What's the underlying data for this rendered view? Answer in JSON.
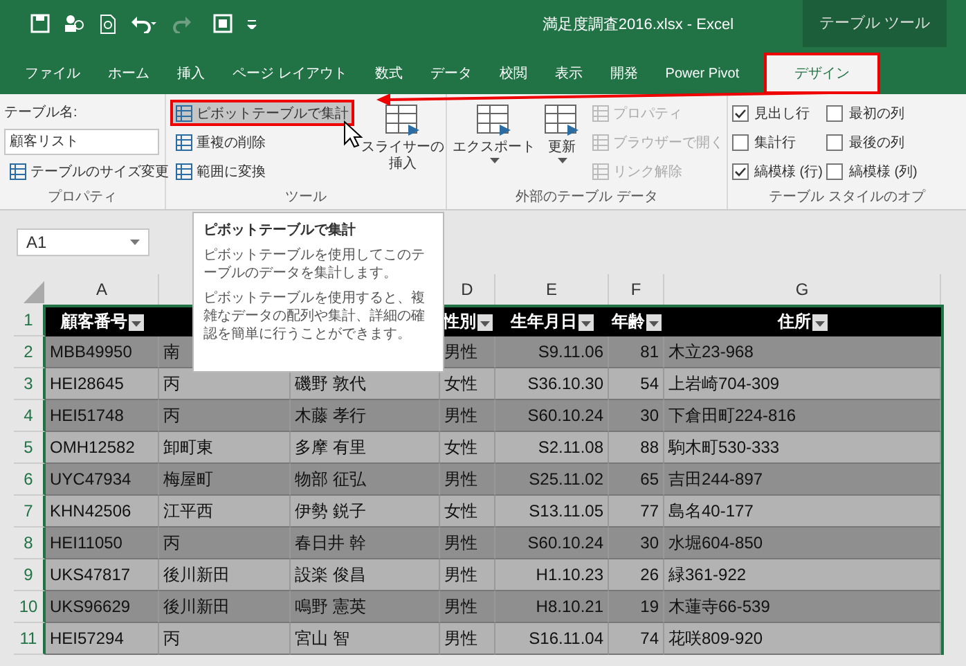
{
  "window": {
    "title": "満足度調査2016.xlsx - Excel",
    "context_label": "テーブル ツール"
  },
  "tabs": [
    {
      "label": "ファイル",
      "selected": false
    },
    {
      "label": "ホーム",
      "selected": false
    },
    {
      "label": "挿入",
      "selected": false
    },
    {
      "label": "ページ レイアウト",
      "selected": false
    },
    {
      "label": "数式",
      "selected": false
    },
    {
      "label": "データ",
      "selected": false
    },
    {
      "label": "校閲",
      "selected": false
    },
    {
      "label": "表示",
      "selected": false
    },
    {
      "label": "開発",
      "selected": false
    },
    {
      "label": "Power Pivot",
      "selected": false
    },
    {
      "label": "デザイン",
      "selected": true
    }
  ],
  "ribbon": {
    "groups": [
      {
        "label": "プロパティ",
        "columns": [
          [
            {
              "kind": "label",
              "label": "テーブル名:"
            },
            {
              "kind": "field",
              "value": "顧客リスト"
            },
            {
              "kind": "small",
              "label": "テーブルのサイズ変更",
              "disabled": false,
              "highlighted": false
            }
          ]
        ]
      },
      {
        "label": "ツール",
        "columns": [
          [
            {
              "kind": "small",
              "label": "ピボットテーブルで集計",
              "disabled": false,
              "highlighted": true
            },
            {
              "kind": "small",
              "label": "重複の削除",
              "disabled": false,
              "highlighted": false
            },
            {
              "kind": "small",
              "label": "範囲に変換",
              "disabled": false,
              "highlighted": false
            }
          ],
          [
            {
              "kind": "large",
              "label": "スライサーの挿入",
              "caret": false
            }
          ]
        ]
      },
      {
        "label": "外部のテーブル データ",
        "columns": [
          [
            {
              "kind": "large",
              "label": "エクスポート",
              "caret": true
            }
          ],
          [
            {
              "kind": "large",
              "label": "更新",
              "caret": true
            }
          ],
          [
            {
              "kind": "small",
              "label": "プロパティ",
              "disabled": true,
              "highlighted": false
            },
            {
              "kind": "small",
              "label": "ブラウザーで開く",
              "disabled": true,
              "highlighted": false
            },
            {
              "kind": "small",
              "label": "リンク解除",
              "disabled": true,
              "highlighted": false
            }
          ]
        ]
      },
      {
        "label": "テーブル スタイルのオプ",
        "columns": [
          [
            {
              "kind": "check",
              "label": "見出し行",
              "checked": true
            },
            {
              "kind": "check",
              "label": "集計行",
              "checked": false
            },
            {
              "kind": "check",
              "label": "縞模様 (行)",
              "checked": true
            }
          ],
          [
            {
              "kind": "check",
              "label": "最初の列",
              "checked": false
            },
            {
              "kind": "check",
              "label": "最後の列",
              "checked": false
            },
            {
              "kind": "check",
              "label": "縞模様 (列)",
              "checked": false
            }
          ]
        ]
      }
    ]
  },
  "name_box": "A1",
  "tooltip": {
    "title": "ピボットテーブルで集計",
    "paragraphs": [
      "ピボットテーブルを使用してこのテーブルのデータを集計します。",
      "ピボットテーブルを使用すると、複雑なデータの配列や集計、詳細の確認を簡単に行うことができます。"
    ]
  },
  "sheet": {
    "columns": [
      {
        "letter": "A",
        "header": "顧客番号"
      },
      {},
      {},
      {
        "letter": "D",
        "header": "性別"
      },
      {
        "letter": "E",
        "header": "生年月日"
      },
      {
        "letter": "F",
        "header": "年齢"
      },
      {
        "letter": "G",
        "header": "住所"
      }
    ],
    "header_row_number": "1",
    "rows": [
      {
        "number": "2",
        "cells": [
          "MBB49950",
          "南",
          null,
          "男性",
          "S9.11.06",
          "81",
          "木立23-968"
        ]
      },
      {
        "number": "3",
        "cells": [
          "HEI28645",
          "丙",
          "磯野 敦代",
          "女性",
          "S36.10.30",
          "54",
          "上岩崎704-309"
        ]
      },
      {
        "number": "4",
        "cells": [
          "HEI51748",
          "丙",
          "木藤 孝行",
          "男性",
          "S60.10.24",
          "30",
          "下倉田町224-816"
        ]
      },
      {
        "number": "5",
        "cells": [
          "OMH12582",
          "卸町東",
          "多摩 有里",
          "女性",
          "S2.11.08",
          "88",
          "駒木町530-333"
        ]
      },
      {
        "number": "6",
        "cells": [
          "UYC47934",
          "梅屋町",
          "物部 征弘",
          "男性",
          "S25.11.02",
          "65",
          "吉田244-897"
        ]
      },
      {
        "number": "7",
        "cells": [
          "KHN42506",
          "江平西",
          "伊勢 鋭子",
          "女性",
          "S13.11.05",
          "77",
          "島名40-177"
        ]
      },
      {
        "number": "8",
        "cells": [
          "HEI11050",
          "丙",
          "春日井 幹",
          "男性",
          "S60.10.24",
          "30",
          "水堀604-850"
        ]
      },
      {
        "number": "9",
        "cells": [
          "UKS47817",
          "後川新田",
          "設楽 俊昌",
          "男性",
          "H1.10.23",
          "26",
          "緑361-922"
        ]
      },
      {
        "number": "10",
        "cells": [
          "UKS96629",
          "後川新田",
          "鳴野 憲英",
          "男性",
          "H8.10.21",
          "19",
          "木蓮寺66-539"
        ]
      },
      {
        "number": "11",
        "cells": [
          "HEI57294",
          "丙",
          "宮山 智",
          "男性",
          "S16.11.04",
          "74",
          "花咲809-920"
        ]
      }
    ]
  }
}
